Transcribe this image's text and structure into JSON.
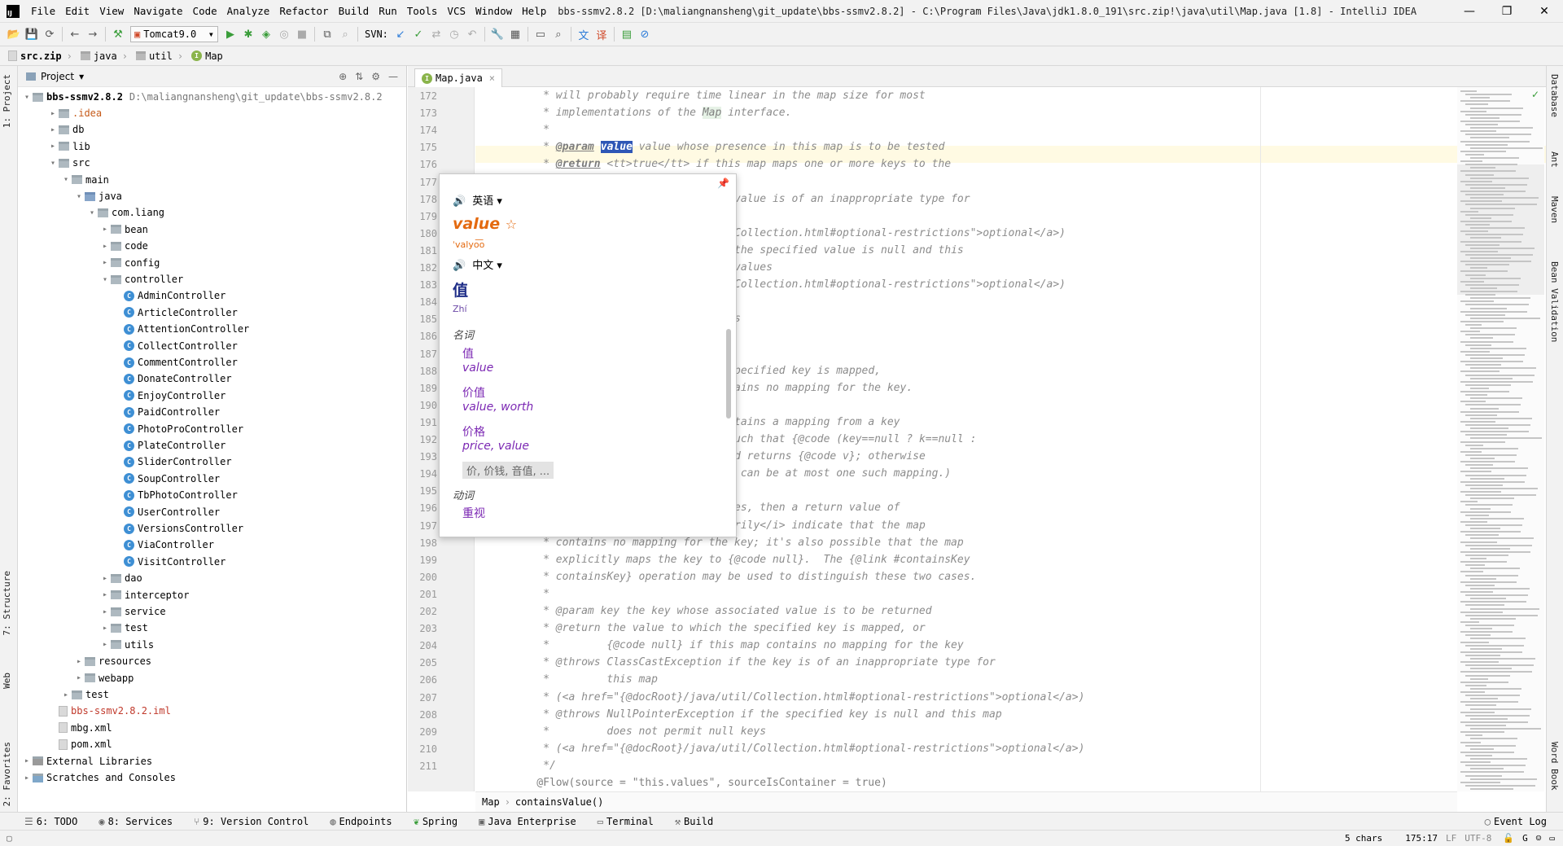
{
  "window": {
    "title": "bbs-ssmv2.8.2 [D:\\maliangnansheng\\git_update\\bbs-ssmv2.8.2] - C:\\Program Files\\Java\\jdk1.8.0_191\\src.zip!\\java\\util\\Map.java [1.8] - IntelliJ IDEA",
    "logo": "IJ"
  },
  "menu": [
    "File",
    "Edit",
    "View",
    "Navigate",
    "Code",
    "Analyze",
    "Refactor",
    "Build",
    "Run",
    "Tools",
    "VCS",
    "Window",
    "Help"
  ],
  "toolbar": {
    "run_config": "Tomcat9.0",
    "svn_label": "SVN:"
  },
  "navbar": {
    "crumbs": [
      "src.zip",
      "java",
      "util",
      "Map"
    ]
  },
  "project_panel": {
    "title": "Project",
    "root_name": "bbs-ssmv2.8.2",
    "root_path": "D:\\maliangnansheng\\git_update\\bbs-ssmv2.8.2",
    "tree": [
      ".idea",
      "db",
      "lib",
      "src",
      "main",
      "java",
      "com.liang",
      "bean",
      "code",
      "config",
      "controller",
      "AdminController",
      "ArticleController",
      "AttentionController",
      "CollectController",
      "CommentController",
      "DonateController",
      "EnjoyController",
      "PaidController",
      "PhotoProController",
      "PlateController",
      "SliderController",
      "SoupController",
      "TbPhotoController",
      "UserController",
      "VersionsController",
      "ViaController",
      "VisitController",
      "dao",
      "interceptor",
      "service",
      "test",
      "utils",
      "resources",
      "webapp",
      "test",
      "bbs-ssmv2.8.2.iml",
      "mbg.xml",
      "pom.xml",
      "External Libraries",
      "Scratches and Consoles"
    ]
  },
  "editor": {
    "tab_name": "Map.java",
    "line_numbers": [
      "172",
      "173",
      "174",
      "175",
      "176",
      "177",
      "178",
      "179",
      "180",
      "181",
      "182",
      "183",
      "184",
      "185",
      "186",
      "187",
      "188",
      "189",
      "190",
      "191",
      "192",
      "193",
      "194",
      "195",
      "196",
      "197",
      "198",
      "199",
      "200",
      "201",
      "202",
      "203",
      "204",
      "205",
      "206",
      "207",
      "208",
      "209",
      "210",
      "211"
    ],
    "lines": {
      "l172": "     * will probably require time linear in the map size for most",
      "l173a": "     * implementations of the ",
      "l173b": "Map",
      "l173c": " interface.",
      "l174": "     *",
      "l175a": "     * ",
      "l175b": "@param",
      "l175c": "value",
      "l175d": " value whose presence in this map is to be tested",
      "l176a": "     * ",
      "l176b": "@return",
      "l176c": " <tt>true</tt> if this map maps one or more keys to the",
      "l178": "value is of an inappropriate type for",
      "l180": "Collection.html#optional-restrictions\">optional</a>)",
      "l181": "the specified value is null and this",
      "l182": "values",
      "l183": "Collection.html#optional-restrictions\">optional</a>)",
      "l185": "s",
      "l188": "pecified key is mapped,",
      "l189": "ains no mapping for the key.",
      "l191": "tains a mapping from a key",
      "l192": "uch that {@code (key==null ? k==null :",
      "l193": "d returns {@code v}; otherwise",
      "l194": " can be at most one such mapping.)",
      "l196": "es, then a return value of",
      "l197": "rily</i> indicate that the map",
      "l198": "     * contains no mapping for the key; it's also possible that the map",
      "l199": "     * explicitly maps the key to {@code null}.  The {@link #containsKey",
      "l200": "     * containsKey} operation may be used to distinguish these two cases.",
      "l201": "     *",
      "l202": "     * @param key the key whose associated value is to be returned",
      "l203": "     * @return the value to which the specified key is mapped, or",
      "l204": "     *         {@code null} if this map contains no mapping for the key",
      "l205": "     * @throws ClassCastException if the key is of an inappropriate type for",
      "l206": "     *         this map",
      "l207": "     * (<a href=\"{@docRoot}/java/util/Collection.html#optional-restrictions\">optional</a>)",
      "l208": "     * @throws NullPointerException if the specified key is null and this map",
      "l209": "     *         does not permit null keys",
      "l210": "     * (<a href=\"{@docRoot}/java/util/Collection.html#optional-restrictions\">optional</a>)",
      "l211": "     */",
      "l212": "    @Flow(source = \"this.values\", sourceIsContainer = true)"
    },
    "breadcrumb": [
      "Map",
      "containsValue()"
    ]
  },
  "translation_popup": {
    "src_lang": "英语",
    "word": "value",
    "phonetic": "ˈvalyo͞o",
    "tgt_lang": "中文",
    "translation": "值",
    "pinyin": "Zhí",
    "pos_noun": "名词",
    "senses": [
      {
        "zh": "值",
        "en": "value"
      },
      {
        "zh": "价值",
        "en": "value, worth"
      },
      {
        "zh": "价格",
        "en": "price, value"
      }
    ],
    "more": "价, 价钱, 音值, ...",
    "pos_verb": "动词",
    "verb_sense": "重视"
  },
  "right_tools": [
    "Database",
    "Ant",
    "Maven",
    "Bean Validation",
    "Word Book"
  ],
  "left_tools": [
    "1: Project",
    "7: Structure",
    "Web",
    "2: Favorites"
  ],
  "bottom_tools": [
    "6: TODO",
    "8: Services",
    "9: Version Control",
    "Endpoints",
    "Spring",
    "Java Enterprise",
    "Terminal",
    "Build",
    "Event Log"
  ],
  "status": {
    "chars": "5 chars",
    "position": "175:17",
    "line_sep": "LF",
    "encoding": "UTF-8"
  },
  "colors": {
    "accent": "#3e8fd4",
    "purple": "#7b27b3",
    "highlight_line": "#fffae3",
    "orange_word": "#e46a10"
  }
}
